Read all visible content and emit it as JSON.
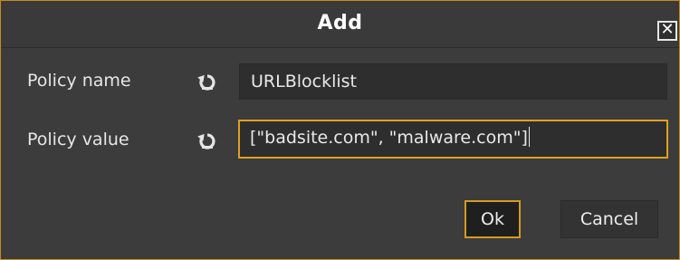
{
  "dialog": {
    "title": "Add",
    "close_glyph": "✕"
  },
  "form": {
    "policy_name": {
      "label": "Policy name",
      "value": "URLBlocklist",
      "reset_icon": "reset-icon"
    },
    "policy_value": {
      "label": "Policy value",
      "value": "[\"badsite.com\", \"malware.com\"]",
      "reset_icon": "reset-icon"
    }
  },
  "buttons": {
    "ok_label": "Ok",
    "cancel_label": "Cancel"
  },
  "colors": {
    "accent": "#d59a22",
    "background": "#3c3c3c",
    "field_bg": "#2e2e2e"
  }
}
